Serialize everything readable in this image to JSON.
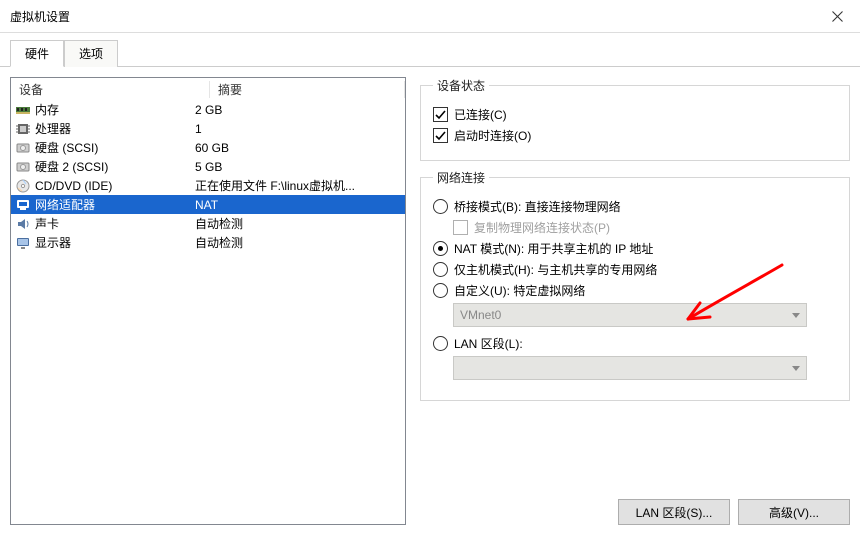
{
  "window": {
    "title": "虚拟机设置"
  },
  "tabs": {
    "hardware": "硬件",
    "options": "选项"
  },
  "table": {
    "head_device": "设备",
    "head_summary": "摘要"
  },
  "devices": [
    {
      "icon": "memory",
      "name": "内存",
      "summary": "2 GB",
      "selected": false
    },
    {
      "icon": "cpu",
      "name": "处理器",
      "summary": "1",
      "selected": false
    },
    {
      "icon": "hdd",
      "name": "硬盘 (SCSI)",
      "summary": "60 GB",
      "selected": false
    },
    {
      "icon": "hdd",
      "name": "硬盘 2 (SCSI)",
      "summary": "5 GB",
      "selected": false
    },
    {
      "icon": "cd",
      "name": "CD/DVD (IDE)",
      "summary": "正在使用文件 F:\\linux虚拟机...",
      "selected": false
    },
    {
      "icon": "net",
      "name": "网络适配器",
      "summary": "NAT",
      "selected": true
    },
    {
      "icon": "sound",
      "name": "声卡",
      "summary": "自动检测",
      "selected": false
    },
    {
      "icon": "display",
      "name": "显示器",
      "summary": "自动检测",
      "selected": false
    }
  ],
  "status": {
    "legend": "设备状态",
    "connected": "已连接(C)",
    "connect_at_power_on": "启动时连接(O)"
  },
  "netconn": {
    "legend": "网络连接",
    "bridged": "桥接模式(B): 直接连接物理网络",
    "replicate": "复制物理网络连接状态(P)",
    "nat": "NAT 模式(N): 用于共享主机的 IP 地址",
    "hostonly": "仅主机模式(H): 与主机共享的专用网络",
    "custom": "自定义(U): 特定虚拟网络",
    "custom_value": "VMnet0",
    "lanseg": "LAN 区段(L):",
    "lanseg_value": ""
  },
  "buttons": {
    "lan_segments": "LAN 区段(S)...",
    "advanced": "高级(V)..."
  }
}
